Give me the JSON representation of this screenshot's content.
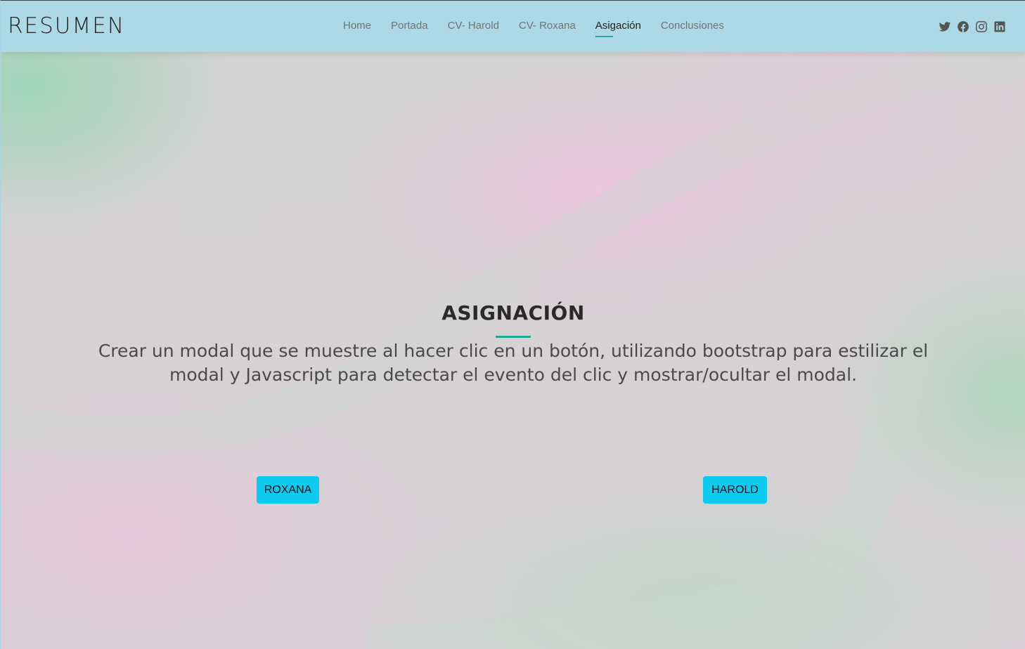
{
  "header": {
    "logo": "RESUMEN",
    "nav": [
      {
        "label": "Home",
        "active": false
      },
      {
        "label": "Portada",
        "active": false
      },
      {
        "label": "CV- Harold",
        "active": false
      },
      {
        "label": "CV- Roxana",
        "active": false
      },
      {
        "label": "Asigación",
        "active": true
      },
      {
        "label": "Conclusiones",
        "active": false
      }
    ],
    "social_icons": [
      "twitter-icon",
      "facebook-icon",
      "instagram-icon",
      "linkedin-icon"
    ]
  },
  "main": {
    "title": "ASIGNACIÓN",
    "description": "Crear un modal que se muestre al hacer clic en un botón, utilizando bootstrap para estilizar el modal y Javascript para detectar el evento del clic y mostrar/ocultar el modal.",
    "buttons": {
      "roxana": "ROXANA",
      "harold": "HAROLD"
    }
  },
  "colors": {
    "header_bg": "#add8e6",
    "accent": "#22a59a",
    "button_bg": "#0dcaf0"
  }
}
